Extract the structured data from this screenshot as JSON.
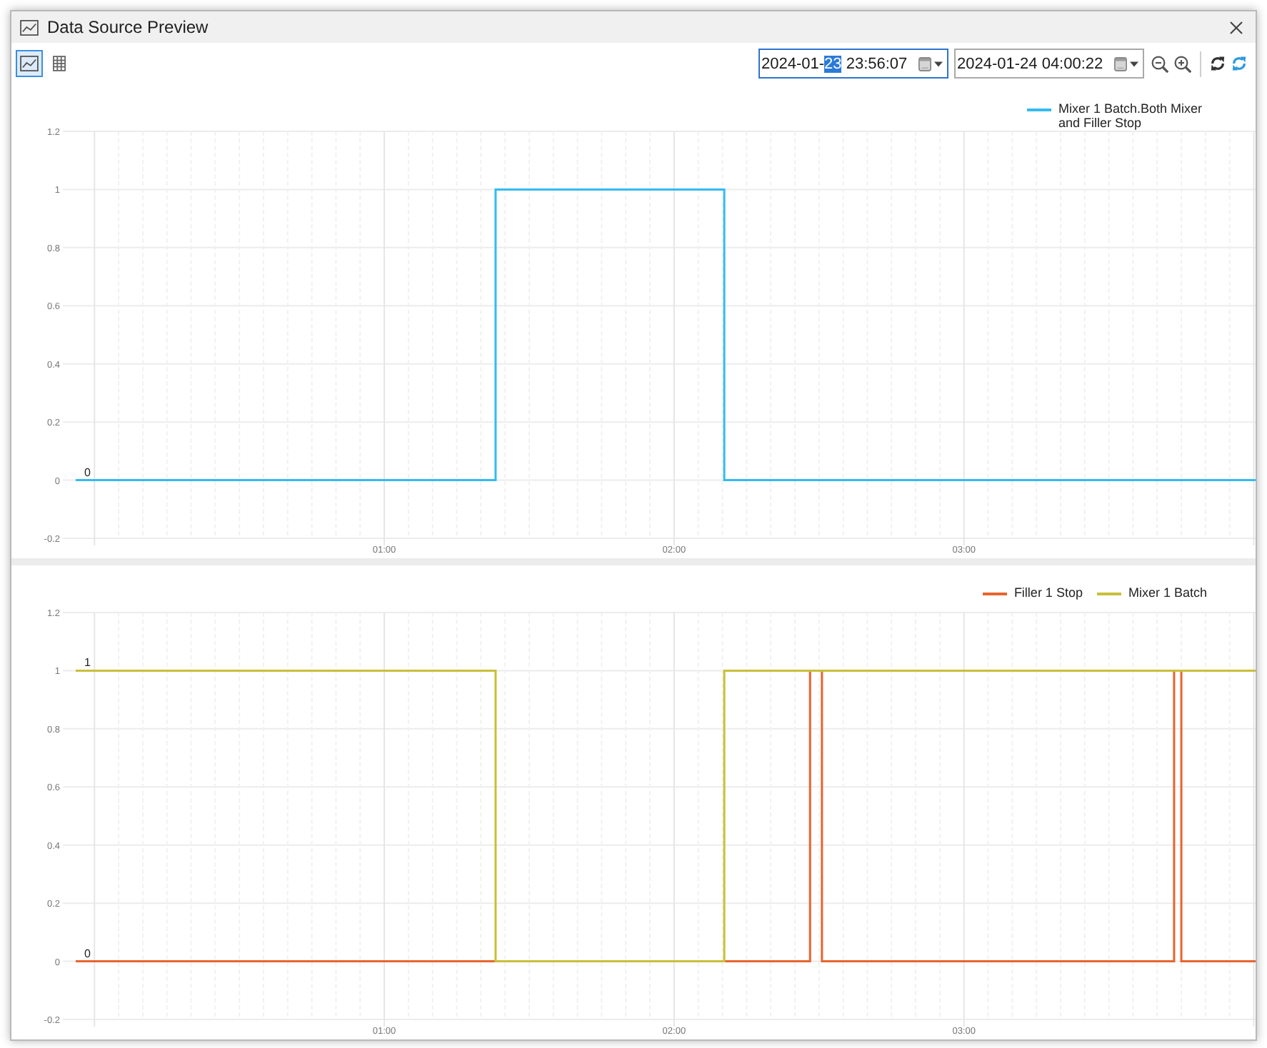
{
  "window": {
    "title": "Data Source Preview"
  },
  "toolbar": {
    "views": [
      {
        "kind": "chart",
        "selected": true
      },
      {
        "kind": "table",
        "selected": false
      }
    ],
    "range_fields": [
      {
        "focused": true,
        "segments": [
          {
            "text": "2024-01-",
            "selected": false
          },
          {
            "text": "23",
            "selected": true
          },
          {
            "text": " 23:56:07",
            "selected": false
          }
        ]
      },
      {
        "focused": false,
        "segments": [
          {
            "text": "2024-01-24 04:00:22",
            "selected": false
          }
        ]
      }
    ]
  },
  "charts": [
    {
      "chart_data": {
        "type": "line",
        "x": [
          -0.0647,
          1.384,
          1.384,
          2.173,
          2.173,
          4.0061
        ],
        "series": [
          {
            "name": "Mixer 1 Batch.Both Mixer and Filler Stop",
            "color": "#33bbf0",
            "values": [
              0,
              0,
              1,
              1,
              0,
              0
            ]
          }
        ],
        "xlim": [
          -0.109,
          4.0061
        ],
        "ylim": [
          -0.2,
          1.2
        ],
        "xticks": [
          {
            "value": 1,
            "label": "01:00"
          },
          {
            "value": 2,
            "label": "02:00"
          },
          {
            "value": 3,
            "label": "03:00"
          }
        ],
        "yticks": [
          -0.2,
          0,
          0.2,
          0.4,
          0.6,
          0.8,
          1,
          1.2
        ],
        "grid": true,
        "legend": true,
        "annotations": [
          {
            "y": 0,
            "text": "0"
          }
        ]
      }
    },
    {
      "chart_data": {
        "type": "line",
        "x": [
          -0.0647,
          1.384,
          1.384,
          2.173,
          2.173,
          2.469,
          2.469,
          2.51,
          2.51,
          3.725,
          3.725,
          3.75,
          3.75,
          4.0061
        ],
        "series": [
          {
            "name": "Filler 1 Stop",
            "color": "#e8642e",
            "values": [
              0,
              0,
              0,
              0,
              0,
              0,
              1,
              1,
              0,
              0,
              1,
              1,
              0,
              0
            ]
          },
          {
            "name": "Mixer 1 Batch",
            "color": "#c8bf3a",
            "values": [
              1,
              1,
              0,
              0,
              1,
              1,
              1,
              1,
              1,
              1,
              1,
              1,
              1,
              1
            ]
          }
        ],
        "xlim": [
          -0.109,
          4.0061
        ],
        "ylim": [
          -0.2,
          1.2
        ],
        "xticks": [
          {
            "value": 1,
            "label": "01:00"
          },
          {
            "value": 2,
            "label": "02:00"
          },
          {
            "value": 3,
            "label": "03:00"
          }
        ],
        "yticks": [
          -0.2,
          0,
          0.2,
          0.4,
          0.6,
          0.8,
          1,
          1.2
        ],
        "grid": true,
        "legend": true,
        "annotations": [
          {
            "y": 1,
            "text": "1"
          },
          {
            "y": 0,
            "text": "0"
          }
        ]
      }
    }
  ]
}
